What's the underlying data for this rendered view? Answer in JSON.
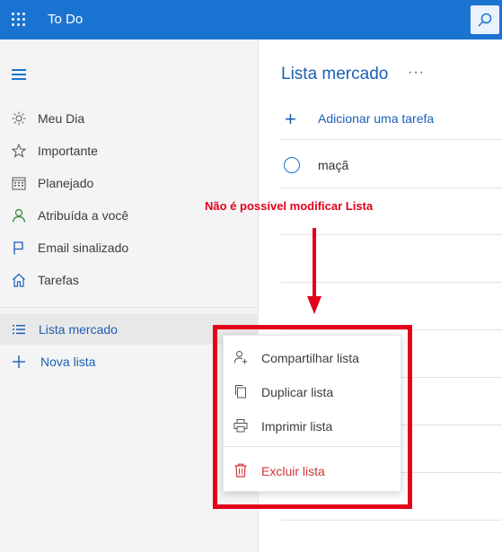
{
  "app": {
    "title": "To Do"
  },
  "sidebar": {
    "items": [
      {
        "label": "Meu Dia",
        "icon": "sun-icon"
      },
      {
        "label": "Importante",
        "icon": "star-icon"
      },
      {
        "label": "Planejado",
        "icon": "calendar-icon"
      },
      {
        "label": "Atribuída a você",
        "icon": "person-icon"
      },
      {
        "label": "Email sinalizado",
        "icon": "flag-icon"
      },
      {
        "label": "Tarefas",
        "icon": "home-icon"
      }
    ],
    "lists": [
      {
        "label": "Lista mercado",
        "icon": "list-icon",
        "selected": true
      }
    ],
    "new_list": "Nova lista"
  },
  "main": {
    "list_title": "Lista mercado",
    "more": "···",
    "add_task": "Adicionar uma tarefa",
    "tasks": [
      {
        "text": "maçã",
        "completed": false
      }
    ]
  },
  "context_menu": {
    "items": [
      {
        "label": "Compartilhar lista",
        "icon": "share-person-icon"
      },
      {
        "label": "Duplicar lista",
        "icon": "copy-icon"
      },
      {
        "label": "Imprimir lista",
        "icon": "printer-icon"
      },
      {
        "label": "Excluir lista",
        "icon": "trash-icon",
        "danger": true
      }
    ]
  },
  "annotation": {
    "text": "Não é possível modificar Lista"
  },
  "colors": {
    "brand": "#1b73d1",
    "accent_text": "#1b5fb5",
    "danger": "#d13438",
    "annotation": "#e3001b"
  }
}
